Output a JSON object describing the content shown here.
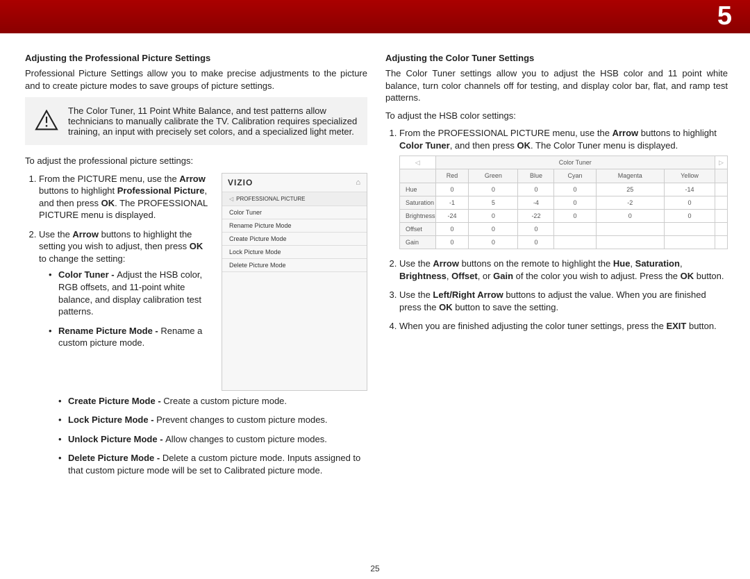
{
  "chapter_number": "5",
  "page_number": "25",
  "left": {
    "heading": "Adjusting the Professional Picture Settings",
    "intro": "Professional Picture Settings allow you to make precise adjustments to the picture and to create picture modes to save groups of picture settings.",
    "warning": "The Color Tuner, 11 Point White Balance, and test patterns allow technicians to manually calibrate the TV. Calibration requires specialized training, an input with precisely set colors, and a specialized light meter.",
    "lead": "To adjust the professional picture settings:",
    "step1_a": "From the PICTURE menu, use the ",
    "step1_b": " buttons to highlight ",
    "step1_c": ", and then press ",
    "step1_d": ". The PROFESSIONAL PICTURE menu is displayed.",
    "step1_arrow": "Arrow",
    "step1_pp": "Professional Picture",
    "step1_ok": "OK",
    "step2_a": "Use the ",
    "step2_b": " buttons to highlight the setting you wish to adjust, then press ",
    "step2_c": " to change the setting:",
    "step2_arrow": "Arrow",
    "step2_ok": "OK",
    "bul_ct_t": "Color Tuner - ",
    "bul_ct": "Adjust the HSB color, RGB offsets, and 11-point white balance, and display calibration test patterns.",
    "bul_rn_t": "Rename Picture Mode - ",
    "bul_rn": "Rename a custom picture mode.",
    "bul_cp_t": "Create Picture Mode - ",
    "bul_cp": "Create a custom picture mode.",
    "bul_lp_t": "Lock Picture Mode - ",
    "bul_lp": "Prevent changes to custom picture modes.",
    "bul_up_t": "Unlock Picture Mode - ",
    "bul_up": "Allow changes to custom picture modes.",
    "bul_dp_t": "Delete Picture Mode - ",
    "bul_dp": "Delete a custom picture mode. Inputs assigned to that custom picture mode will be set to Calibrated picture mode.",
    "menu": {
      "brand": "VIZIO",
      "crumb": "PROFESSIONAL PICTURE",
      "items": [
        "Color Tuner",
        "Rename Picture Mode",
        "Create Picture Mode",
        "Lock Picture Mode",
        "Delete Picture Mode"
      ]
    }
  },
  "right": {
    "heading": "Adjusting the Color Tuner Settings",
    "intro": "The Color Tuner settings allow you to adjust the HSB color and 11 point white balance, turn color channels off for testing, and display color bar, flat, and ramp test patterns.",
    "lead": "To adjust the HSB color settings:",
    "s1_a": "From the PROFESSIONAL PICTURE menu, use the ",
    "s1_arrow": "Arrow",
    "s1_b": " buttons to highlight ",
    "s1_ct": "Color Tuner",
    "s1_c": ", and then press ",
    "s1_ok": "OK",
    "s1_d": ". The Color Tuner menu is displayed.",
    "s2_a": "Use the ",
    "s2_arrow": "Arrow",
    "s2_b": " buttons on the remote to highlight the ",
    "s2_hue": "Hue",
    "s2_c": ", ",
    "s2_sat": "Saturation",
    "s2_d": ", ",
    "s2_bri": "Brightness",
    "s2_e": ", ",
    "s2_off": "Offset",
    "s2_f": ", or ",
    "s2_gain": "Gain",
    "s2_g": " of the color you wish to adjust. Press the ",
    "s2_ok": "OK",
    "s2_h": "  button.",
    "s3_a": "Use the ",
    "s3_lr": "Left/Right Arrow",
    "s3_b": " buttons to adjust the value. When you are finished press the ",
    "s3_ok": "OK",
    "s3_c": " button to save the setting.",
    "s4_a": "When you are finished adjusting the color tuner settings, press the ",
    "s4_exit": "EXIT",
    "s4_b": " button.",
    "table": {
      "title": "Color Tuner",
      "cols": [
        "Red",
        "Green",
        "Blue",
        "Cyan",
        "Magenta",
        "Yellow"
      ],
      "rows": [
        {
          "label": "Hue",
          "v": [
            "0",
            "0",
            "0",
            "0",
            "25",
            "-14"
          ]
        },
        {
          "label": "Saturation",
          "v": [
            "-1",
            "5",
            "-4",
            "0",
            "-2",
            "0"
          ]
        },
        {
          "label": "Brightness",
          "v": [
            "-24",
            "0",
            "-22",
            "0",
            "0",
            "0"
          ]
        },
        {
          "label": "Offset",
          "v": [
            "0",
            "0",
            "0",
            "",
            "",
            ""
          ]
        },
        {
          "label": "Gain",
          "v": [
            "0",
            "0",
            "0",
            "",
            "",
            ""
          ]
        }
      ]
    }
  }
}
